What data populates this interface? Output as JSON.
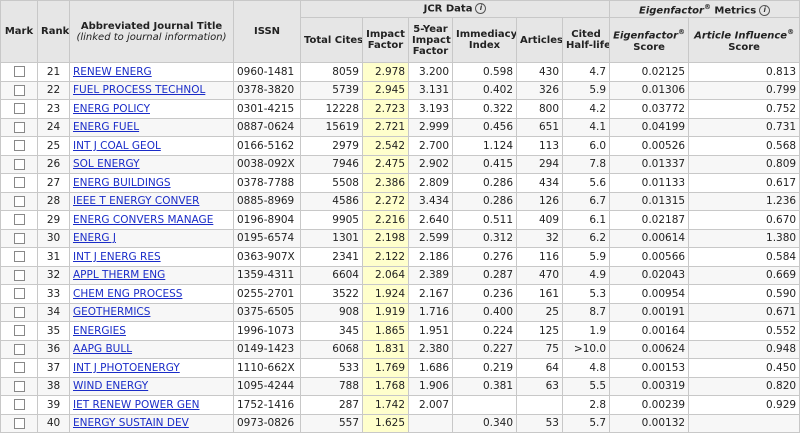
{
  "headers": {
    "mark": "Mark",
    "rank": "Rank",
    "title": "Abbreviated Journal Title",
    "title_sub": "(linked to journal information)",
    "issn": "ISSN",
    "jcr_group": "JCR Data",
    "eigen_group_a": "Eigenfactor",
    "eigen_group_b": " Metrics",
    "total_cites": "Total Cites",
    "impact_factor_a": "Impact",
    "impact_factor_b": "Factor",
    "five_year_a": "5-Year",
    "five_year_b": "Impact",
    "five_year_c": "Factor",
    "immediacy_a": "Immediacy",
    "immediacy_b": "Index",
    "articles": "Articles",
    "half_life_a": "Cited",
    "half_life_b": "Half-life",
    "eigen_score_a": "Eigenfactor",
    "eigen_score_b": "Score",
    "ai_score_a": "Article Influence",
    "ai_score_b": "Score",
    "reg": "®",
    "info": "i"
  },
  "rows": [
    {
      "rank": "21",
      "title": "RENEW ENERG",
      "issn": "0960-1481",
      "total_cites": "8059",
      "impact_factor": "2.978",
      "five_year": "3.200",
      "immediacy": "0.598",
      "articles": "430",
      "half_life": "4.7",
      "eigen": "0.02125",
      "ai": "0.813"
    },
    {
      "rank": "22",
      "title": "FUEL PROCESS TECHNOL",
      "issn": "0378-3820",
      "total_cites": "5739",
      "impact_factor": "2.945",
      "five_year": "3.131",
      "immediacy": "0.402",
      "articles": "326",
      "half_life": "5.9",
      "eigen": "0.01306",
      "ai": "0.799"
    },
    {
      "rank": "23",
      "title": "ENERG POLICY",
      "issn": "0301-4215",
      "total_cites": "12228",
      "impact_factor": "2.723",
      "five_year": "3.193",
      "immediacy": "0.322",
      "articles": "800",
      "half_life": "4.2",
      "eigen": "0.03772",
      "ai": "0.752"
    },
    {
      "rank": "24",
      "title": "ENERG FUEL",
      "issn": "0887-0624",
      "total_cites": "15619",
      "impact_factor": "2.721",
      "five_year": "2.999",
      "immediacy": "0.456",
      "articles": "651",
      "half_life": "4.1",
      "eigen": "0.04199",
      "ai": "0.731"
    },
    {
      "rank": "25",
      "title": "INT J COAL GEOL",
      "issn": "0166-5162",
      "total_cites": "2979",
      "impact_factor": "2.542",
      "five_year": "2.700",
      "immediacy": "1.124",
      "articles": "113",
      "half_life": "6.0",
      "eigen": "0.00526",
      "ai": "0.568"
    },
    {
      "rank": "26",
      "title": "SOL ENERGY",
      "issn": "0038-092X",
      "total_cites": "7946",
      "impact_factor": "2.475",
      "five_year": "2.902",
      "immediacy": "0.415",
      "articles": "294",
      "half_life": "7.8",
      "eigen": "0.01337",
      "ai": "0.809"
    },
    {
      "rank": "27",
      "title": "ENERG BUILDINGS",
      "issn": "0378-7788",
      "total_cites": "5508",
      "impact_factor": "2.386",
      "five_year": "2.809",
      "immediacy": "0.286",
      "articles": "434",
      "half_life": "5.6",
      "eigen": "0.01133",
      "ai": "0.617"
    },
    {
      "rank": "28",
      "title": "IEEE T ENERGY CONVER",
      "issn": "0885-8969",
      "total_cites": "4586",
      "impact_factor": "2.272",
      "five_year": "3.434",
      "immediacy": "0.286",
      "articles": "126",
      "half_life": "6.7",
      "eigen": "0.01315",
      "ai": "1.236"
    },
    {
      "rank": "29",
      "title": "ENERG CONVERS MANAGE",
      "issn": "0196-8904",
      "total_cites": "9905",
      "impact_factor": "2.216",
      "five_year": "2.640",
      "immediacy": "0.511",
      "articles": "409",
      "half_life": "6.1",
      "eigen": "0.02187",
      "ai": "0.670"
    },
    {
      "rank": "30",
      "title": "ENERG J",
      "issn": "0195-6574",
      "total_cites": "1301",
      "impact_factor": "2.198",
      "five_year": "2.599",
      "immediacy": "0.312",
      "articles": "32",
      "half_life": "6.2",
      "eigen": "0.00614",
      "ai": "1.380"
    },
    {
      "rank": "31",
      "title": "INT J ENERG RES",
      "issn": "0363-907X",
      "total_cites": "2341",
      "impact_factor": "2.122",
      "five_year": "2.186",
      "immediacy": "0.276",
      "articles": "116",
      "half_life": "5.9",
      "eigen": "0.00566",
      "ai": "0.584"
    },
    {
      "rank": "32",
      "title": "APPL THERM ENG",
      "issn": "1359-4311",
      "total_cites": "6604",
      "impact_factor": "2.064",
      "five_year": "2.389",
      "immediacy": "0.287",
      "articles": "470",
      "half_life": "4.9",
      "eigen": "0.02043",
      "ai": "0.669"
    },
    {
      "rank": "33",
      "title": "CHEM ENG PROCESS",
      "issn": "0255-2701",
      "total_cites": "3522",
      "impact_factor": "1.924",
      "five_year": "2.167",
      "immediacy": "0.236",
      "articles": "161",
      "half_life": "5.3",
      "eigen": "0.00954",
      "ai": "0.590"
    },
    {
      "rank": "34",
      "title": "GEOTHERMICS",
      "issn": "0375-6505",
      "total_cites": "908",
      "impact_factor": "1.919",
      "five_year": "1.716",
      "immediacy": "0.400",
      "articles": "25",
      "half_life": "8.7",
      "eigen": "0.00191",
      "ai": "0.671"
    },
    {
      "rank": "35",
      "title": "ENERGIES",
      "issn": "1996-1073",
      "total_cites": "345",
      "impact_factor": "1.865",
      "five_year": "1.951",
      "immediacy": "0.224",
      "articles": "125",
      "half_life": "1.9",
      "eigen": "0.00164",
      "ai": "0.552"
    },
    {
      "rank": "36",
      "title": "AAPG BULL",
      "issn": "0149-1423",
      "total_cites": "6068",
      "impact_factor": "1.831",
      "five_year": "2.380",
      "immediacy": "0.227",
      "articles": "75",
      "half_life": ">10.0",
      "eigen": "0.00624",
      "ai": "0.948"
    },
    {
      "rank": "37",
      "title": "INT J PHOTOENERGY",
      "issn": "1110-662X",
      "total_cites": "533",
      "impact_factor": "1.769",
      "five_year": "1.686",
      "immediacy": "0.219",
      "articles": "64",
      "half_life": "4.8",
      "eigen": "0.00153",
      "ai": "0.450"
    },
    {
      "rank": "38",
      "title": "WIND ENERGY",
      "issn": "1095-4244",
      "total_cites": "788",
      "impact_factor": "1.768",
      "five_year": "1.906",
      "immediacy": "0.381",
      "articles": "63",
      "half_life": "5.5",
      "eigen": "0.00319",
      "ai": "0.820"
    },
    {
      "rank": "39",
      "title": "IET RENEW POWER GEN",
      "issn": "1752-1416",
      "total_cites": "287",
      "impact_factor": "1.742",
      "five_year": "2.007",
      "immediacy": "",
      "articles": "",
      "half_life": "2.8",
      "eigen": "0.00239",
      "ai": "0.929"
    },
    {
      "rank": "40",
      "title": "ENERGY SUSTAIN DEV",
      "issn": "0973-0826",
      "total_cites": "557",
      "impact_factor": "1.625",
      "five_year": "",
      "immediacy": "0.340",
      "articles": "53",
      "half_life": "5.7",
      "eigen": "0.00132",
      "ai": ""
    }
  ]
}
